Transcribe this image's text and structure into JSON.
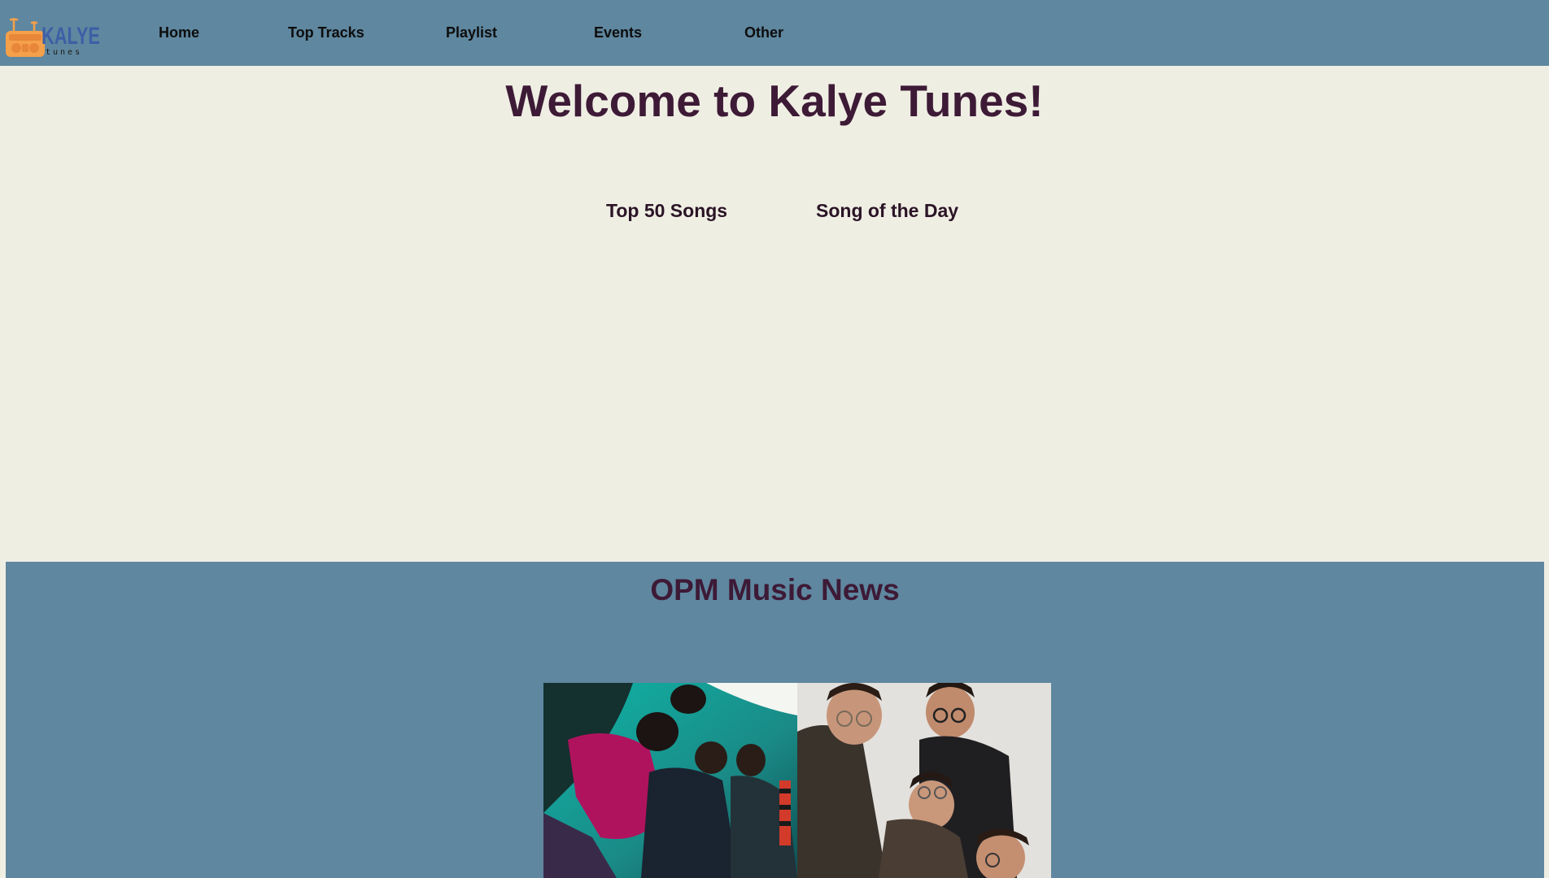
{
  "header": {
    "logo_text": "KALYE",
    "logo_subtext": "tunes",
    "nav": [
      {
        "label": "Home"
      },
      {
        "label": "Top Tracks"
      },
      {
        "label": "Playlist"
      },
      {
        "label": "Events"
      },
      {
        "label": "Other"
      }
    ]
  },
  "main": {
    "title": "Welcome to Kalye Tunes!",
    "links": [
      {
        "label": "Top 50 Songs"
      },
      {
        "label": "Song of the Day"
      }
    ]
  },
  "news": {
    "title": "OPM Music News",
    "images": [
      {
        "name": "band-photo-teal"
      },
      {
        "name": "band-photo-gray"
      }
    ]
  },
  "colors": {
    "header_bg": "#5f879f",
    "page_bg": "#efeee3",
    "title": "#3d1a36",
    "logo_orange": "#f5a04a",
    "logo_blue": "#3d5fa6"
  }
}
